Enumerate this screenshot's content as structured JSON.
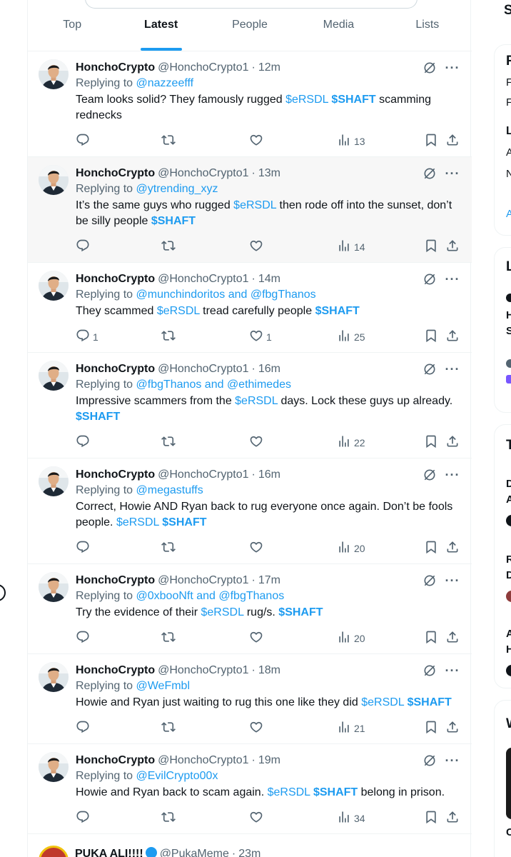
{
  "tabs": [
    {
      "label": "Top",
      "active": false
    },
    {
      "label": "Latest",
      "active": true
    },
    {
      "label": "People",
      "active": false
    },
    {
      "label": "Media",
      "active": false
    },
    {
      "label": "Lists",
      "active": false
    }
  ],
  "tweets": [
    {
      "name": "HonchoCrypto",
      "handle": "@HonchoCrypto1",
      "time": "12m",
      "replying_label": "Replying to",
      "mentions": "@nazzeefff",
      "text_segments": [
        {
          "t": "Team looks solid? They famously rugged ",
          "k": "plain"
        },
        {
          "t": "$eRSDL",
          "k": "cashtag"
        },
        {
          "t": " ",
          "k": "plain"
        },
        {
          "t": "$SHAFT",
          "k": "cashtag-bold"
        },
        {
          "t": " scamming rednecks",
          "k": "plain"
        }
      ],
      "replies": "",
      "likes": "",
      "views": "13",
      "highlight": false
    },
    {
      "name": "HonchoCrypto",
      "handle": "@HonchoCrypto1",
      "time": "13m",
      "replying_label": "Replying to",
      "mentions": "@ytrending_xyz",
      "text_segments": [
        {
          "t": "It’s the same guys who rugged ",
          "k": "plain"
        },
        {
          "t": "$eRSDL",
          "k": "cashtag"
        },
        {
          "t": " then rode off into the sunset, don’t be silly people ",
          "k": "plain"
        },
        {
          "t": "$SHAFT",
          "k": "cashtag-bold"
        }
      ],
      "replies": "",
      "likes": "",
      "views": "14",
      "highlight": true
    },
    {
      "name": "HonchoCrypto",
      "handle": "@HonchoCrypto1",
      "time": "14m",
      "replying_label": "Replying to",
      "mentions": "@munchindoritos and @fbgThanos",
      "text_segments": [
        {
          "t": "They scammed ",
          "k": "plain"
        },
        {
          "t": "$eRSDL",
          "k": "cashtag"
        },
        {
          "t": " tread carefully people ",
          "k": "plain"
        },
        {
          "t": "$SHAFT",
          "k": "cashtag-bold"
        }
      ],
      "replies": "1",
      "likes": "1",
      "views": "25",
      "highlight": false
    },
    {
      "name": "HonchoCrypto",
      "handle": "@HonchoCrypto1",
      "time": "16m",
      "replying_label": "Replying to",
      "mentions": "@fbgThanos and @ethimedes",
      "text_segments": [
        {
          "t": "Impressive scammers from the ",
          "k": "plain"
        },
        {
          "t": "$eRSDL",
          "k": "cashtag"
        },
        {
          "t": " days. Lock these guys up already. ",
          "k": "plain"
        },
        {
          "t": "$SHAFT",
          "k": "cashtag-bold"
        }
      ],
      "replies": "",
      "likes": "",
      "views": "22",
      "highlight": false
    },
    {
      "name": "HonchoCrypto",
      "handle": "@HonchoCrypto1",
      "time": "16m",
      "replying_label": "Replying to",
      "mentions": "@megastuffs",
      "text_segments": [
        {
          "t": "Correct, Howie AND Ryan back to rug everyone once again. Don’t be fools people. ",
          "k": "plain"
        },
        {
          "t": "$eRSDL",
          "k": "cashtag"
        },
        {
          "t": " ",
          "k": "plain"
        },
        {
          "t": "$SHAFT",
          "k": "cashtag-bold"
        }
      ],
      "replies": "",
      "likes": "",
      "views": "20",
      "highlight": false
    },
    {
      "name": "HonchoCrypto",
      "handle": "@HonchoCrypto1",
      "time": "17m",
      "replying_label": "Replying to",
      "mentions": "@0xbooNft and @fbgThanos",
      "text_segments": [
        {
          "t": "Try the evidence of their ",
          "k": "plain"
        },
        {
          "t": "$eRSDL",
          "k": "cashtag"
        },
        {
          "t": " rug/s. ",
          "k": "plain"
        },
        {
          "t": "$SHAFT",
          "k": "cashtag-bold"
        }
      ],
      "replies": "",
      "likes": "",
      "views": "20",
      "highlight": false
    },
    {
      "name": "HonchoCrypto",
      "handle": "@HonchoCrypto1",
      "time": "18m",
      "replying_label": "Replying to",
      "mentions": "@WeFmbl",
      "text_segments": [
        {
          "t": "Howie and Ryan just waiting to rug this one like they did ",
          "k": "plain"
        },
        {
          "t": "$eRSDL",
          "k": "cashtag"
        },
        {
          "t": " ",
          "k": "plain"
        },
        {
          "t": "$SHAFT",
          "k": "cashtag-bold"
        }
      ],
      "replies": "",
      "likes": "",
      "views": "21",
      "highlight": false
    },
    {
      "name": "HonchoCrypto",
      "handle": "@HonchoCrypto1",
      "time": "19m",
      "replying_label": "Replying to",
      "mentions": "@EvilCrypto00x",
      "text_segments": [
        {
          "t": "Howie and Ryan back to scam again. ",
          "k": "plain"
        },
        {
          "t": "$eRSDL",
          "k": "cashtag"
        },
        {
          "t": " ",
          "k": "plain"
        },
        {
          "t": "$SHAFT",
          "k": "cashtag-bold"
        },
        {
          "t": " belong in prison.",
          "k": "plain"
        }
      ],
      "replies": "",
      "likes": "",
      "views": "34",
      "highlight": false
    }
  ],
  "partial_tweet": {
    "name": "PUKA ALI!!!!",
    "handle": "@PukaMeme",
    "time": "23m"
  },
  "sidebar_fragments": {
    "s1": "S",
    "r1": "F",
    "r2": "F",
    "r3": "F",
    "l1": "L",
    "a1": "A",
    "n1": "N",
    "a2": "A",
    "l2": "L",
    "h1": "H",
    "s2": "S",
    "t1": "T",
    "d1": "D",
    "a3": "A",
    "r4": "R",
    "d2": "D",
    "a4": "A",
    "h2": "H",
    "w1": "W",
    "c1": "C"
  },
  "colors": {
    "accent": "#1d9bf0",
    "text": "#0f1419",
    "muted": "#536471"
  }
}
